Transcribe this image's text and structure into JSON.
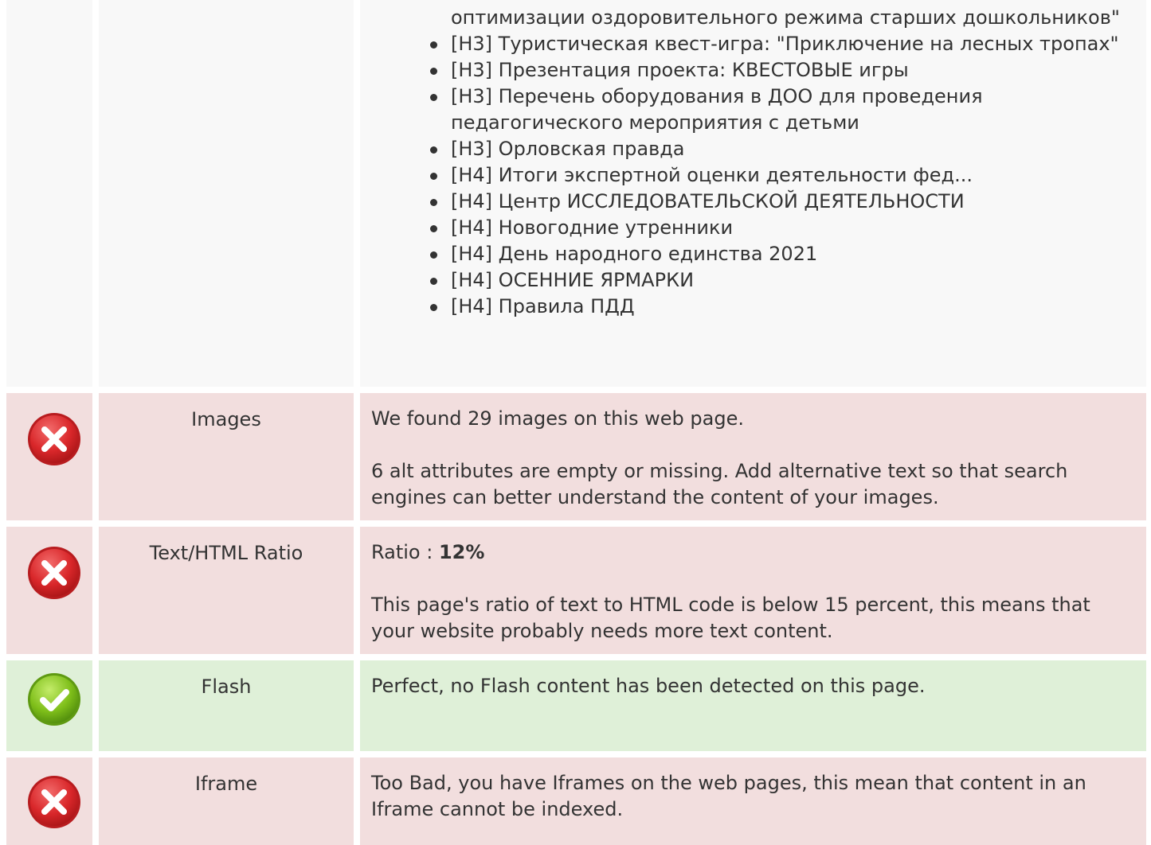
{
  "headings_section": {
    "continued_text": "оптимизации оздоровительного режима старших дошкольников\"",
    "items": [
      "[H3] Туристическая квест-игра: \"Приключение на лесных тропах\"",
      "[H3] Презентация проекта: КВЕСТОВЫЕ игры",
      "[H3] Перечень оборудования в ДОО для проведения педагогического мероприятия с детьми",
      "[H3] Орловская правда",
      "[H4] Итоги экспертной оценки деятельности фед...",
      "[H4] Центр ИССЛЕДОВАТЕЛЬСКОЙ ДЕЯТЕЛЬНОСТИ",
      "[H4] Новогодние утренники",
      "[H4] День народного единства 2021",
      "[H4] ОСЕННИЕ ЯРМАРКИ",
      "[H4] Правила ПДД"
    ]
  },
  "checks": {
    "images": {
      "status": "error",
      "status_icon": "cross-icon",
      "label": "Images",
      "line1": "We found 29 images on this web page.",
      "line2": "6 alt attributes are empty or missing. Add alternative text so that search engines can better understand the content of your images."
    },
    "text_html_ratio": {
      "status": "error",
      "status_icon": "cross-icon",
      "label": "Text/HTML Ratio",
      "ratio_prefix": "Ratio : ",
      "ratio_value": "12%",
      "line2": "This page's ratio of text to HTML code is below 15 percent, this means that your website probably needs more text content."
    },
    "flash": {
      "status": "success",
      "status_icon": "check-icon",
      "label": "Flash",
      "line1": "Perfect, no Flash content has been detected on this page."
    },
    "iframe": {
      "status": "error",
      "status_icon": "cross-icon",
      "label": "Iframe",
      "line1": "Too Bad, you have Iframes on the web pages, this mean that content in an Iframe cannot be indexed."
    }
  },
  "colors": {
    "error_row": "#f2dede",
    "success_row": "#dff0d8",
    "neutral_row": "#f8f8f8",
    "error_icon": "#d9272a",
    "success_icon": "#7fbf1a"
  }
}
